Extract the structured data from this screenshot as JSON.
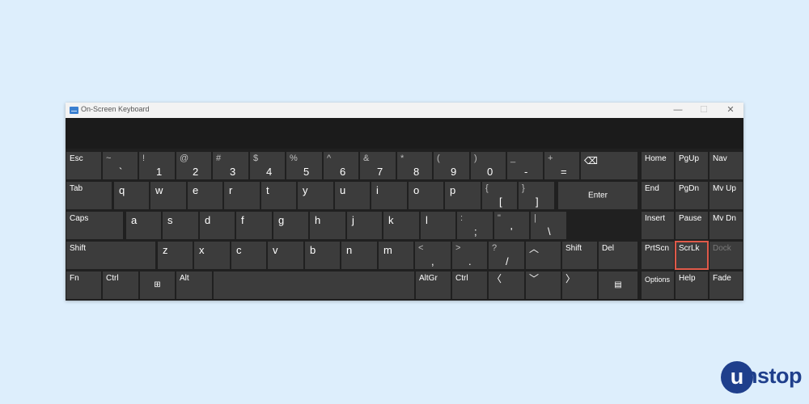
{
  "window": {
    "title": "On-Screen Keyboard",
    "icon": "keyboard-app-icon",
    "minimize_glyph": "—",
    "maximize_glyph": "☐",
    "close_glyph": "✕"
  },
  "text_preview": "",
  "keys": {
    "esc": "Esc",
    "tilde": {
      "shift": "~",
      "main": "`"
    },
    "k1": {
      "shift": "!",
      "main": "1"
    },
    "k2": {
      "shift": "@",
      "main": "2"
    },
    "k3": {
      "shift": "#",
      "main": "3"
    },
    "k4": {
      "shift": "$",
      "main": "4"
    },
    "k5": {
      "shift": "%",
      "main": "5"
    },
    "k6": {
      "shift": "^",
      "main": "6"
    },
    "k7": {
      "shift": "&",
      "main": "7"
    },
    "k8": {
      "shift": "*",
      "main": "8"
    },
    "k9": {
      "shift": "(",
      "main": "9"
    },
    "k0": {
      "shift": ")",
      "main": "0"
    },
    "minus": {
      "shift": "_",
      "main": "-"
    },
    "equals": {
      "shift": "+",
      "main": "="
    },
    "backspace": {
      "icon": "backspace-icon",
      "glyph": "⌫"
    },
    "tab": "Tab",
    "q": "q",
    "w": "w",
    "e": "e",
    "r": "r",
    "t": "t",
    "y": "y",
    "u": "u",
    "i": "i",
    "o": "o",
    "p": "p",
    "lbracket": {
      "shift": "{",
      "main": "["
    },
    "rbracket": {
      "shift": "}",
      "main": "]"
    },
    "enter": "Enter",
    "caps": "Caps",
    "a": "a",
    "s": "s",
    "d": "d",
    "f": "f",
    "g": "g",
    "h": "h",
    "j": "j",
    "k": "k",
    "l": "l",
    "semicolon": {
      "shift": ":",
      "main": ";"
    },
    "quote": {
      "shift": "\"",
      "main": "'"
    },
    "backslash": {
      "shift": "|",
      "main": "\\"
    },
    "lshift": "Shift",
    "z": "z",
    "x": "x",
    "c": "c",
    "v": "v",
    "b": "b",
    "n": "n",
    "m": "m",
    "comma": {
      "shift": "<",
      "main": ","
    },
    "period": {
      "shift": ">",
      "main": "."
    },
    "slash": {
      "shift": "?",
      "main": "/"
    },
    "up": {
      "icon": "up-arrow-icon",
      "glyph": "︿"
    },
    "rshift": "Shift",
    "del": "Del",
    "fn": "Fn",
    "lctrl": "Ctrl",
    "win": {
      "icon": "windows-logo-icon",
      "glyph": "⊞"
    },
    "alt": "Alt",
    "altgr": "AltGr",
    "rctrl": "Ctrl",
    "left": {
      "icon": "left-arrow-icon",
      "glyph": "〈"
    },
    "down": {
      "icon": "down-arrow-icon",
      "glyph": "﹀"
    },
    "right": {
      "icon": "right-arrow-icon",
      "glyph": "〉"
    },
    "menu": {
      "icon": "context-menu-icon",
      "glyph": "▤"
    },
    "home": "Home",
    "pgup": "PgUp",
    "nav": "Nav",
    "end": "End",
    "pgdn": "PgDn",
    "mvup": "Mv Up",
    "insert": "Insert",
    "pause": "Pause",
    "mvdn": "Mv Dn",
    "prtscn": "PrtScn",
    "scrlk": "ScrLk",
    "dock": "Dock",
    "options": "Options",
    "help": "Help",
    "fade": "Fade"
  },
  "highlight_key": "ScrLk",
  "colors": {
    "page_bg": "#ddeefc",
    "key_bg": "#3c3c3c",
    "highlight": "#e05a4a",
    "brand": "#1f3f8c"
  },
  "branding": {
    "logo_letter": "u",
    "logo_text": "nstop"
  }
}
